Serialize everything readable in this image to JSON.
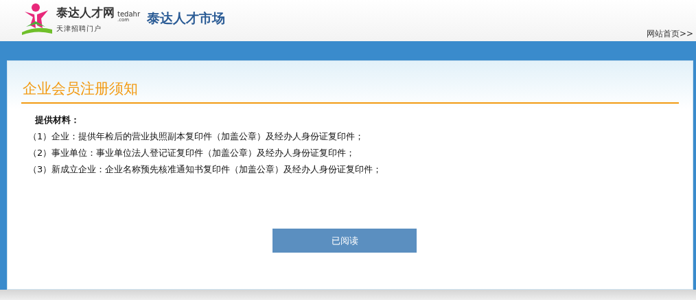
{
  "header": {
    "logo_name": "泰达人才网",
    "logo_domain_1": "tedahr",
    "logo_domain_2": ".com",
    "logo_slogan": "天津招聘门户",
    "site_name": "泰达人才市场",
    "home_link": "网站首页>>"
  },
  "notice": {
    "title": "企业会员注册须知",
    "heading": "提供材料：",
    "items": [
      "（1）企业：提供年检后的营业执照副本复印件（加盖公章）及经办人身份证复印件；",
      "（2）事业单位：事业单位法人登记证复印件（加盖公章）及经办人身份证复印件；",
      "（3）新成立企业：企业名称预先核准通知书复印件（加盖公章）及经办人身份证复印件；"
    ],
    "button": "已阅读"
  }
}
